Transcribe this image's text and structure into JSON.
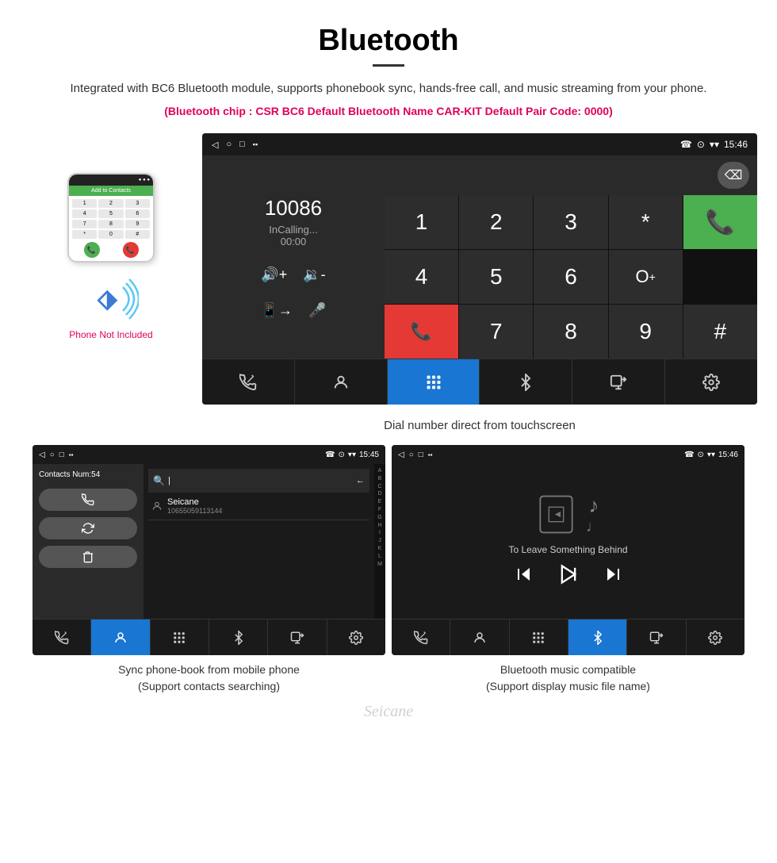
{
  "page": {
    "title": "Bluetooth",
    "divider": true,
    "description": "Integrated with BC6 Bluetooth module, supports phonebook sync, hands-free call, and music streaming from your phone.",
    "specs": "(Bluetooth chip : CSR BC6    Default Bluetooth Name CAR-KIT    Default Pair Code: 0000)"
  },
  "dial_screen": {
    "status_bar": {
      "left_icons": [
        "◁",
        "○",
        "□",
        "▪▪"
      ],
      "right_icons": [
        "☎",
        "⊙",
        "▾▾",
        "15:46"
      ]
    },
    "left_panel": {
      "number": "10086",
      "status": "InCalling...",
      "timer": "00:00",
      "vol_up": "◀+",
      "vol_down": "◀-",
      "transfer": "📱→",
      "mic": "🎤"
    },
    "numpad": {
      "keys": [
        "1",
        "2",
        "3",
        "*",
        "",
        "4",
        "5",
        "6",
        "0+",
        "",
        "7",
        "8",
        "9",
        "#",
        ""
      ],
      "call_green": "☎",
      "call_red": "☎"
    },
    "nav_bar": {
      "items": [
        "☎↗",
        "👤",
        "⠿",
        "✱",
        "📱→",
        "⚙"
      ]
    },
    "active_nav": 2
  },
  "phone_side": {
    "header": "Add to Contacts",
    "numkeys": [
      "1",
      "2",
      "3",
      "4",
      "5",
      "6",
      "7",
      "8",
      "9",
      "*",
      "0",
      "#"
    ],
    "not_included": "Phone Not Included"
  },
  "dial_caption": "Dial number direct from touchscreen",
  "contacts_screen": {
    "status_bar": {
      "left_icons": [
        "◁",
        "○",
        "□",
        "▪▪"
      ],
      "right_icons": [
        "☎",
        "⊙",
        "▾▾",
        "15:45"
      ]
    },
    "contacts_num": "Contacts Num:54",
    "buttons": [
      "☎",
      "↺",
      "🗑"
    ],
    "search_placeholder": "",
    "contact": {
      "name": "Seicane",
      "number": "10655059113144"
    },
    "alphabet": [
      "A",
      "B",
      "C",
      "D",
      "E",
      "F",
      "G",
      "H",
      "I",
      "J",
      "K",
      "L",
      "M"
    ],
    "nav_bar": {
      "items": [
        "☎↗",
        "👤",
        "⠿",
        "✱",
        "📱→",
        "⚙"
      ]
    },
    "active_nav": 1
  },
  "music_screen": {
    "status_bar": {
      "left_icons": [
        "◁",
        "○",
        "□",
        "▪▪"
      ],
      "right_icons": [
        "☎",
        "⊙",
        "▾▾",
        "15:46"
      ]
    },
    "song_title": "To Leave Something Behind",
    "controls": {
      "prev": "⏮",
      "play_pause": "⏭",
      "next": "⏭"
    },
    "nav_bar": {
      "items": [
        "☎↗",
        "👤",
        "⠿",
        "✱",
        "📱→",
        "⚙"
      ]
    },
    "active_nav": 3
  },
  "captions": {
    "contacts": "Sync phone-book from mobile phone\n(Support contacts searching)",
    "music": "Bluetooth music compatible\n(Support display music file name)"
  },
  "watermark": "Seicane"
}
